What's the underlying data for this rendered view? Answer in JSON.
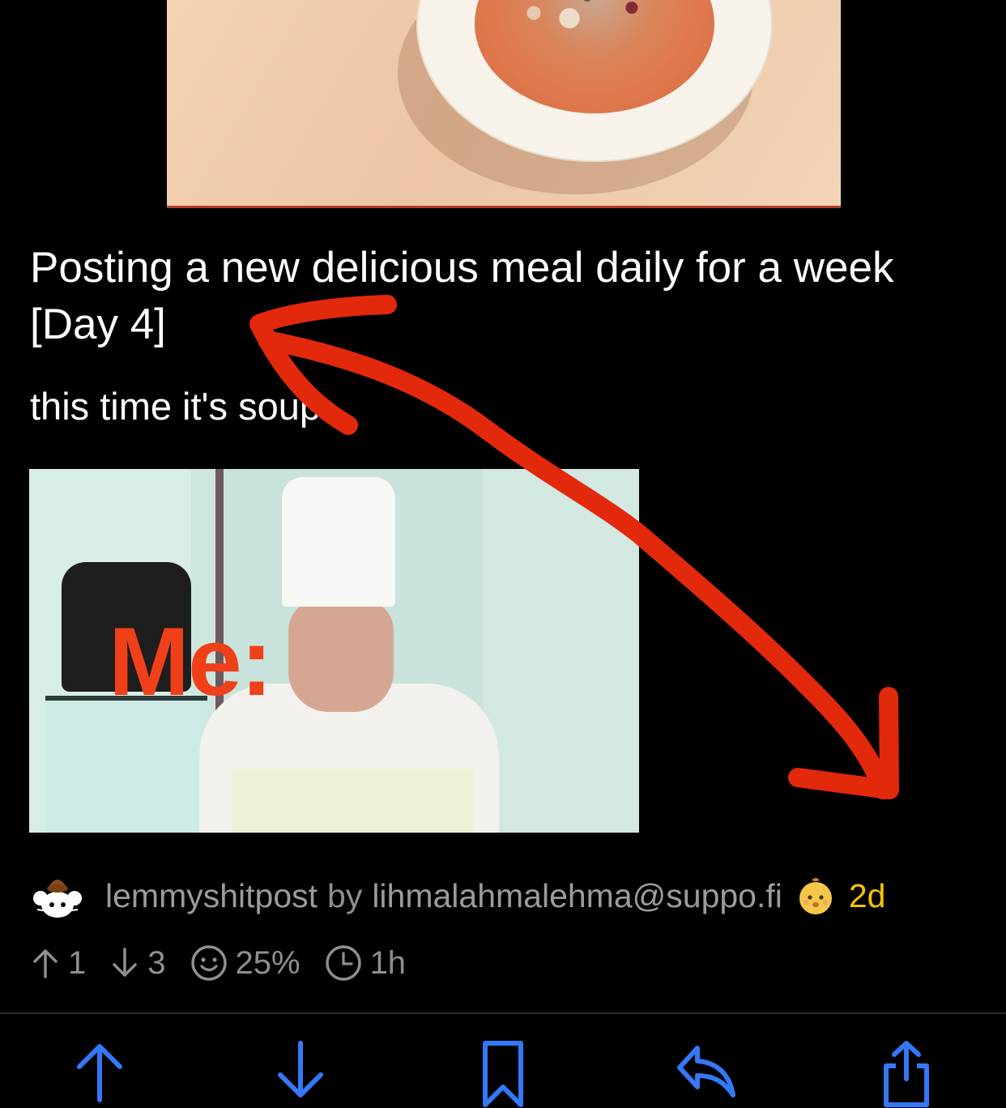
{
  "post": {
    "title": "Posting a new delicious meal daily for a week [Day 4]",
    "body": "this time it's soup",
    "meme_caption": "Me:"
  },
  "meta": {
    "community": "lemmyshitpost",
    "by": "by",
    "author": "lihmalahmalehma@suppo.fi",
    "age": "2d"
  },
  "stats": {
    "upvotes": "1",
    "downvotes": "3",
    "ratio": "25%",
    "time": "1h"
  },
  "actions": [
    {
      "icon": "upvote-arrow-icon"
    },
    {
      "icon": "downvote-arrow-icon"
    },
    {
      "icon": "bookmark-icon"
    },
    {
      "icon": "reply-icon"
    },
    {
      "icon": "share-icon"
    }
  ],
  "colors": {
    "accent": "#3478f6",
    "age": "#f5c400",
    "annotation": "#e3290b",
    "meta_text": "#8e8e93"
  }
}
